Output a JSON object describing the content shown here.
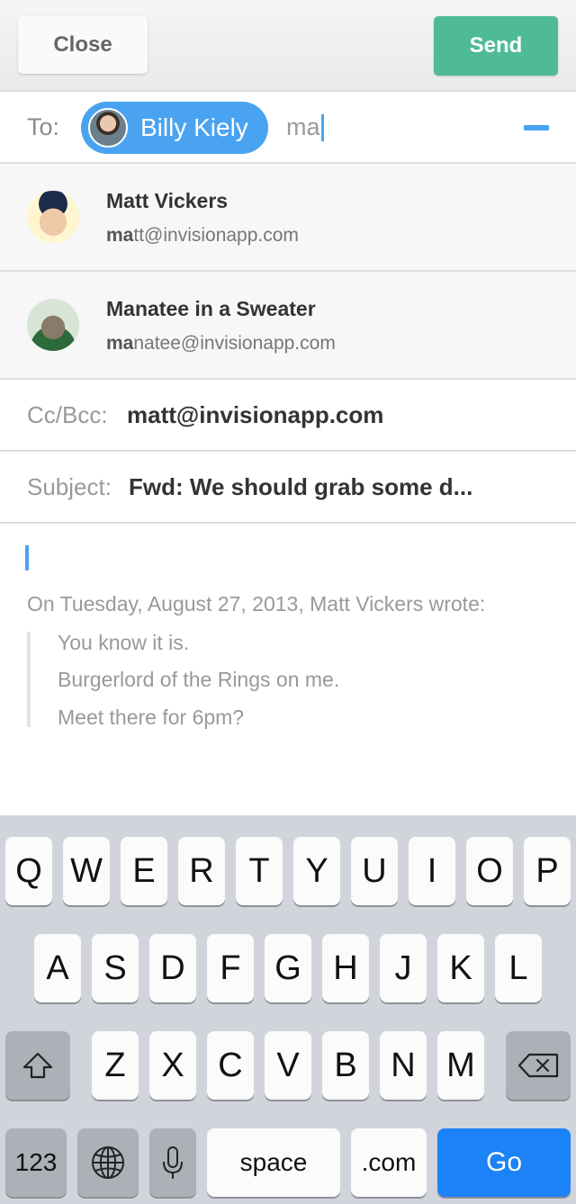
{
  "header": {
    "close_label": "Close",
    "send_label": "Send"
  },
  "to": {
    "label": "To:",
    "recipient_chip": "Billy Kiely",
    "input_value": "ma"
  },
  "suggestions": [
    {
      "name": "Matt Vickers",
      "email_match": "ma",
      "email_rest": "tt@invisionapp.com"
    },
    {
      "name": "Manatee in a Sweater",
      "email_match": "ma",
      "email_rest": "natee@invisionapp.com"
    }
  ],
  "cc": {
    "label": "Cc/Bcc:",
    "value": "matt@invisionapp.com"
  },
  "subject": {
    "label": "Subject:",
    "value": "Fwd: We should grab some d..."
  },
  "body": {
    "quote_header": "On Tuesday, August 27, 2013, Matt Vickers wrote:",
    "quote_lines": [
      "You know it is.",
      "Burgerlord of the Rings on me.",
      "Meet there for 6pm?"
    ]
  },
  "keyboard": {
    "row1": [
      "Q",
      "W",
      "E",
      "R",
      "T",
      "Y",
      "U",
      "I",
      "O",
      "P"
    ],
    "row2": [
      "A",
      "S",
      "D",
      "F",
      "G",
      "H",
      "J",
      "K",
      "L"
    ],
    "row3": [
      "Z",
      "X",
      "C",
      "V",
      "B",
      "N",
      "M"
    ],
    "numbers_label": "123",
    "space_label": "space",
    "dotcom_label": ".com",
    "go_label": "Go",
    "icons": {
      "shift": "shift-icon",
      "delete": "delete-icon",
      "globe": "globe-icon",
      "mic": "microphone-icon"
    }
  },
  "colors": {
    "accent": "#4aa3f0",
    "send": "#4fbb94",
    "go": "#1c82f7"
  }
}
